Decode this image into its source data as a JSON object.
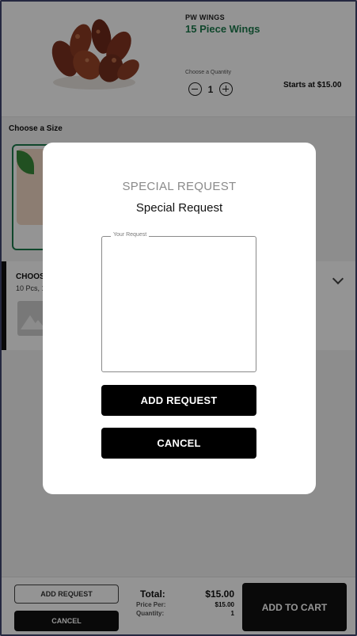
{
  "product": {
    "brand": "PW WINGS",
    "title": "15 Piece Wings",
    "quantity_label": "Choose a Quantity",
    "quantity": "1",
    "starts_at": "Starts at $15.00"
  },
  "sections": {
    "size_title": "Choose a Size",
    "choose_title": "CHOOS",
    "choose_subtitle": "10 Pcs, 1"
  },
  "footer": {
    "add_request_label": "ADD REQUEST",
    "cancel_label": "CANCEL",
    "total_label": "Total:",
    "total_value": "$15.00",
    "price_per_label": "Price Per:",
    "price_per_value": "$15.00",
    "quantity_label": "Quantity:",
    "quantity_value": "1",
    "add_to_cart_label": "ADD TO CART"
  },
  "modal": {
    "heading": "SPECIAL REQUEST",
    "subheading": "Special Request",
    "request_field_label": "Your Request",
    "request_value": "",
    "add_request_label": "ADD REQUEST",
    "cancel_label": "CANCEL"
  },
  "colors": {
    "accent_green": "#1c7a4d",
    "primary_button": "#000000",
    "overlay": "rgba(0,0,0,0.42)"
  },
  "icons": {
    "minus": "minus-circle-icon",
    "plus": "plus-circle-icon",
    "chevron": "chevron-down-icon",
    "image_placeholder": "image-placeholder-icon"
  }
}
